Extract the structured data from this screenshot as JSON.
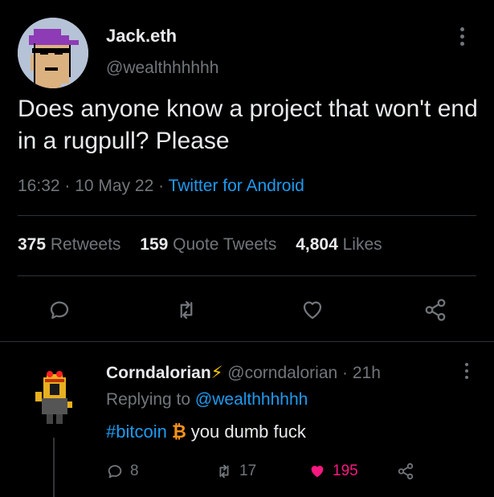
{
  "tweet": {
    "author_name": "Jack.eth",
    "author_handle": "@wealthhhhhh",
    "text": "Does anyone know a project that won't end in a rugpull? Please",
    "time": "16:32",
    "date": "10 May 22",
    "source": "Twitter for Android",
    "retweets_count": "375",
    "retweets_label": "Retweets",
    "quotes_count": "159",
    "quotes_label": "Quote Tweets",
    "likes_count": "4,804",
    "likes_label": "Likes"
  },
  "reply": {
    "author_name": "Corndalorian",
    "emoji": "⚡",
    "author_handle": "@corndalorian",
    "time": "21h",
    "replying_prefix": "Replying to",
    "replying_to": "@wealthhhhhh",
    "hashtag": "#bitcoin",
    "btc_symbol": "₿",
    "text": "you dumb fuck",
    "replies_count": "8",
    "retweets_count": "17",
    "likes_count": "195"
  },
  "colors": {
    "accent": "#1d9bf0",
    "like": "#f91880",
    "muted": "#71767b",
    "background": "#000000"
  },
  "icons": [
    "reply-icon",
    "retweet-icon",
    "like-icon",
    "share-icon",
    "more-icon"
  ]
}
